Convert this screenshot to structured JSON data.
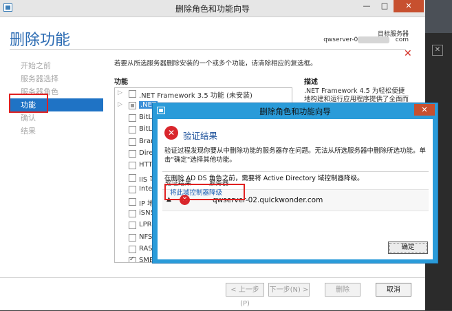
{
  "main_window": {
    "title": "删除角色和功能向导",
    "minimize": "—",
    "maximize": "□",
    "close": "✕"
  },
  "header": {
    "page_title": "删除功能",
    "target_server_label": "目标服务器",
    "target_server_name_prefix": "qwserver-02.",
    "target_server_name_suffix": "com"
  },
  "nav": {
    "items": [
      {
        "label": "开始之前",
        "active": false
      },
      {
        "label": "服务器选择",
        "active": false
      },
      {
        "label": "服务器角色",
        "active": false
      },
      {
        "label": "功能",
        "active": true
      },
      {
        "label": "确认",
        "active": false
      },
      {
        "label": "结果",
        "active": false
      }
    ]
  },
  "content": {
    "instruction": "若要从所选服务器删除安装的一个或多个功能，请清除相应的复选框。",
    "features_header": "功能",
    "description_header": "描述",
    "features": [
      {
        "label": ".NET Framework 3.5 功能 (未安装)",
        "expand": "▷",
        "state": "unchecked"
      },
      {
        "label": ".NET",
        "expand": "▷",
        "state": "partial",
        "selected": true
      },
      {
        "label": "BitLo",
        "expand": "",
        "state": "unchecked"
      },
      {
        "label": "BitLo",
        "expand": "",
        "state": "unchecked"
      },
      {
        "label": "Bran",
        "expand": "",
        "state": "unchecked"
      },
      {
        "label": "Dire",
        "expand": "",
        "state": "unchecked"
      },
      {
        "label": "HTTI",
        "expand": "",
        "state": "unchecked"
      },
      {
        "label": "IIS 可",
        "expand": "",
        "state": "unchecked"
      },
      {
        "label": "Inter",
        "expand": "",
        "state": "unchecked"
      },
      {
        "label": "IP 地",
        "expand": "",
        "state": "unchecked"
      },
      {
        "label": "iSNS",
        "expand": "",
        "state": "unchecked"
      },
      {
        "label": "LPR",
        "expand": "",
        "state": "unchecked"
      },
      {
        "label": "NFS",
        "expand": "",
        "state": "unchecked"
      },
      {
        "label": "RAS",
        "expand": "",
        "state": "unchecked"
      },
      {
        "label": "SME",
        "expand": "",
        "state": "checked"
      }
    ],
    "description": ".NET Framework 4.5 为轻松便捷地构建和运行应用程序提供了全面而一"
  },
  "footer": {
    "prev": "< 上一步(P)",
    "next": "下一步(N) >",
    "remove": "删除",
    "cancel": "取消"
  },
  "dialog": {
    "title": "删除角色和功能向导",
    "close": "✕",
    "heading": "验证结果",
    "message": "验证过程发现你要从中删除功能的服务器存在问题。无法从所选服务器中删除所选功能。单击\"确定\"选择其他功能。",
    "col_result": "验证结果",
    "col_server": "服务器",
    "row_expand": "▲",
    "error_glyph": "✕",
    "server_name": "qwserver-02.quickwonder.com",
    "row_detail": "在删除 AD DS 角色之前，需要将 Active Directory 域控制器降级。",
    "demote_link": "将此域控制器降级",
    "ok_button": "确定"
  },
  "colors": {
    "accent_blue": "#1f73c5",
    "dialog_frame": "#2a9bd9",
    "error_red": "#d9262c",
    "annotation_red": "#e02020"
  }
}
